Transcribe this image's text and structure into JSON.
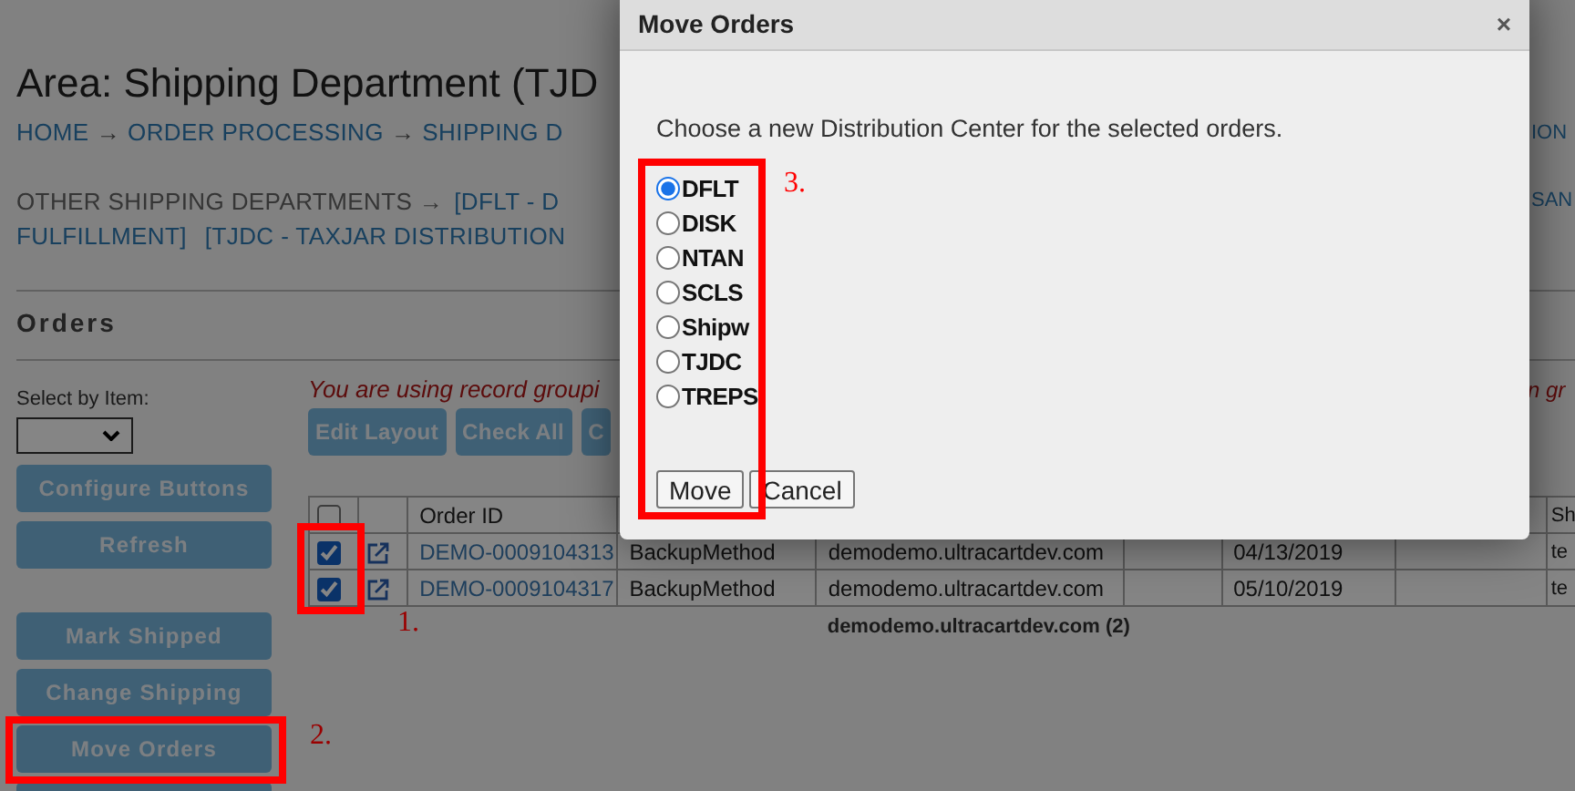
{
  "page": {
    "title": "Area: Shipping Department (TJD",
    "breadcrumbs": {
      "items": [
        "HOME",
        "ORDER PROCESSING",
        "SHIPPING D"
      ],
      "separator": "→",
      "overflow": "ION"
    },
    "other_departments": {
      "label": "OTHER SHIPPING DEPARTMENTS →",
      "line1_link": "[DFLT - D",
      "line1_overflow": "SAN",
      "line2_links": [
        "FULFILLMENT]",
        "[TJDC - TAXJAR DISTRIBUTION"
      ]
    },
    "section_title": "Orders"
  },
  "sidebar": {
    "select_label": "Select by Item:",
    "button_groups": [
      [
        "Configure Buttons",
        "Refresh"
      ],
      [
        "Mark Shipped",
        "Change Shipping",
        "Move Orders"
      ]
    ]
  },
  "notice": {
    "text": "You are using record groupi",
    "overflow": "n gr"
  },
  "toolbar": [
    "Edit Layout",
    "Check All",
    "C"
  ],
  "table": {
    "header": {
      "checked": false,
      "order_id": "Order ID",
      "column_9": "Sh"
    },
    "rows": [
      {
        "checked": true,
        "order_id": "DEMO-0009104313",
        "column_4": "BackupMethod",
        "column_5": "demodemo.ultracartdev.com",
        "column_7": "04/13/2019",
        "column_9": "te"
      },
      {
        "checked": true,
        "order_id": "DEMO-0009104317",
        "column_4": "BackupMethod",
        "column_5": "demodemo.ultracartdev.com",
        "column_7": "05/10/2019",
        "column_9": "te"
      }
    ],
    "group_footer": "demodemo.ultracartdev.com (2)"
  },
  "dialog": {
    "title": "Move Orders",
    "close": "×",
    "prompt": "Choose a new Distribution Center for the selected orders.",
    "options": [
      {
        "label": "DFLT",
        "selected": true
      },
      {
        "label": "DISK",
        "selected": false
      },
      {
        "label": "NTAN",
        "selected": false
      },
      {
        "label": "SCLS",
        "selected": false
      },
      {
        "label": "Shipw",
        "selected": false
      },
      {
        "label": "TJDC",
        "selected": false
      },
      {
        "label": "TREPS",
        "selected": false
      }
    ],
    "buttons": [
      "Move",
      "Cancel"
    ]
  },
  "annotations": [
    "1.",
    "2.",
    "3."
  ]
}
